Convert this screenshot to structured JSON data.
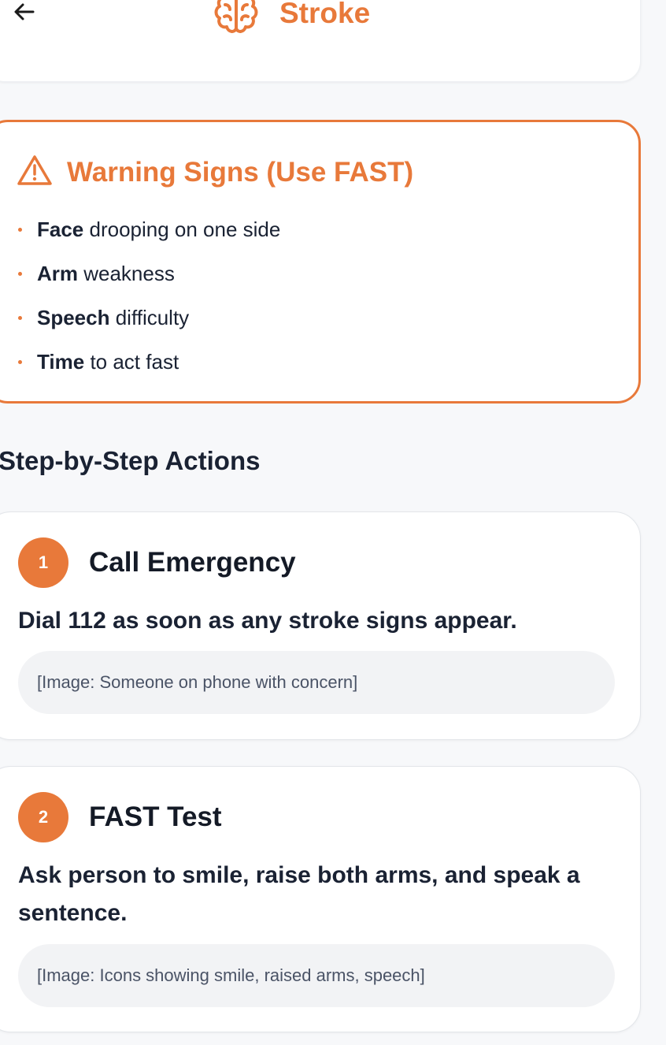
{
  "header": {
    "title": "Stroke",
    "back_icon": "arrow-left-icon",
    "title_icon": "brain-icon"
  },
  "warning": {
    "icon": "alert-triangle-icon",
    "title": "Warning Signs (Use FAST)",
    "items": [
      {
        "bold": "Face",
        "rest": " drooping on one side"
      },
      {
        "bold": "Arm",
        "rest": " weakness"
      },
      {
        "bold": "Speech",
        "rest": " difficulty"
      },
      {
        "bold": "Time",
        "rest": " to act fast"
      }
    ]
  },
  "section": {
    "title": "Step-by-Step Actions"
  },
  "steps": [
    {
      "number": "1",
      "title": "Call Emergency",
      "description": "Dial 112 as soon as any stroke signs appear.",
      "image_placeholder": "[Image: Someone on phone with concern]"
    },
    {
      "number": "2",
      "title": "FAST Test",
      "description": "Ask person to smile, raise both arms, and speak a sentence.",
      "image_placeholder": "[Image: Icons showing smile, raised arms, speech]"
    }
  ],
  "colors": {
    "accent": "#e8793a",
    "text": "#1a2233",
    "background": "#f7f8fa"
  }
}
